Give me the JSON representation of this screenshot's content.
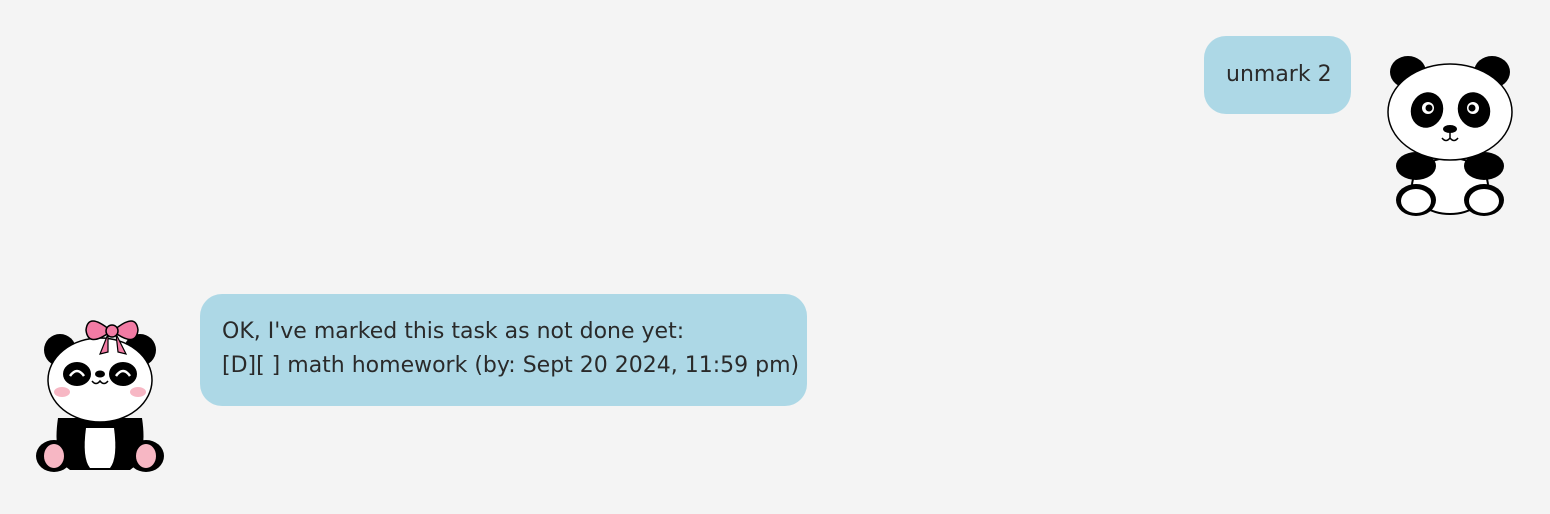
{
  "messages": [
    {
      "sender": "user",
      "lines": [
        "unmark 2"
      ],
      "avatar_icon": "panda-icon"
    },
    {
      "sender": "bot",
      "lines": [
        "OK, I've marked this task as not done yet:",
        "[D][ ] math homework (by: Sept 20 2024, 11:59 pm)"
      ],
      "avatar_icon": "girl-panda-with-bow-icon"
    }
  ],
  "colors": {
    "background": "#f4f4f4",
    "bubble": "#add8e6",
    "text": "#2a2a2a",
    "bow": "#f27ba4",
    "cheeks": "#f7b7c4"
  }
}
